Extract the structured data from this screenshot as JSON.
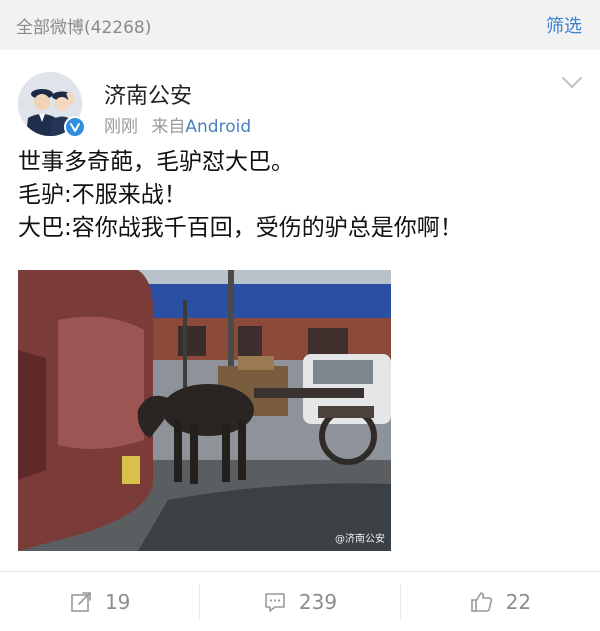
{
  "header": {
    "count_label": "全部微博(42268)",
    "filter_label": "筛选"
  },
  "post": {
    "author": "济南公安",
    "time": "刚刚",
    "source_prefix": "来自",
    "source": "Android",
    "lines": [
      "世事多奇葩，毛驴怼大巴。",
      "毛驴:不服来战！",
      "大巴:容你战我千百回，受伤的驴总是你啊！"
    ],
    "watermark": "@济南公安"
  },
  "actions": {
    "repost_count": "19",
    "comment_count": "239",
    "like_count": "22"
  },
  "icons": {
    "verified": "verified-badge-icon",
    "chevron": "chevron-down-icon",
    "repost": "repost-icon",
    "comment": "comment-icon",
    "like": "thumbs-up-icon"
  },
  "colors": {
    "accent": "#3a7fd1",
    "verified": "#2f8ee0",
    "muted": "#8c8c8c"
  }
}
